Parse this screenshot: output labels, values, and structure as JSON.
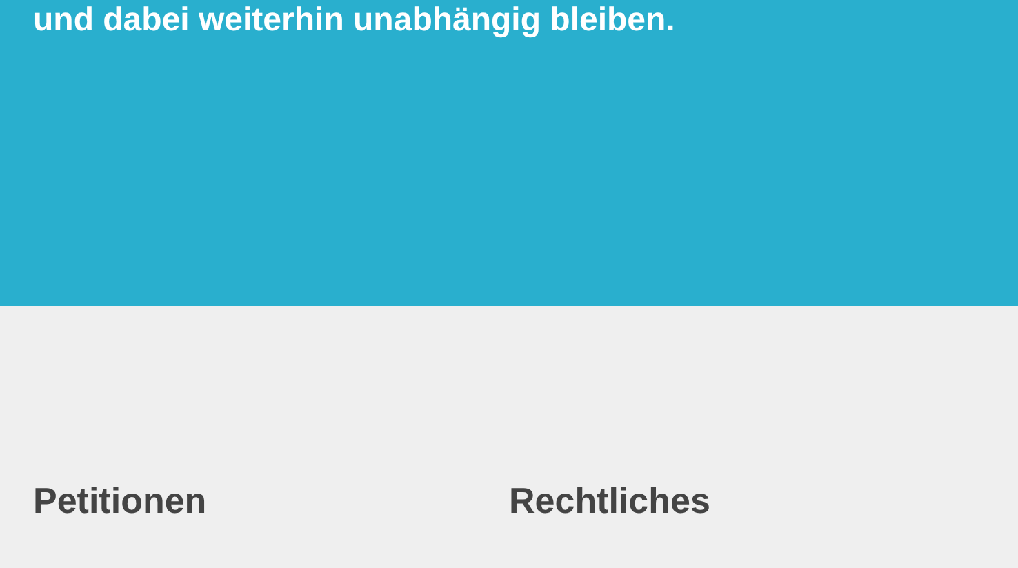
{
  "banner": {
    "text": "und dabei weiterhin unabhängig bleiben."
  },
  "footer": {
    "columns": [
      {
        "heading": "Petitionen"
      },
      {
        "heading": "Rechtliches"
      }
    ]
  }
}
